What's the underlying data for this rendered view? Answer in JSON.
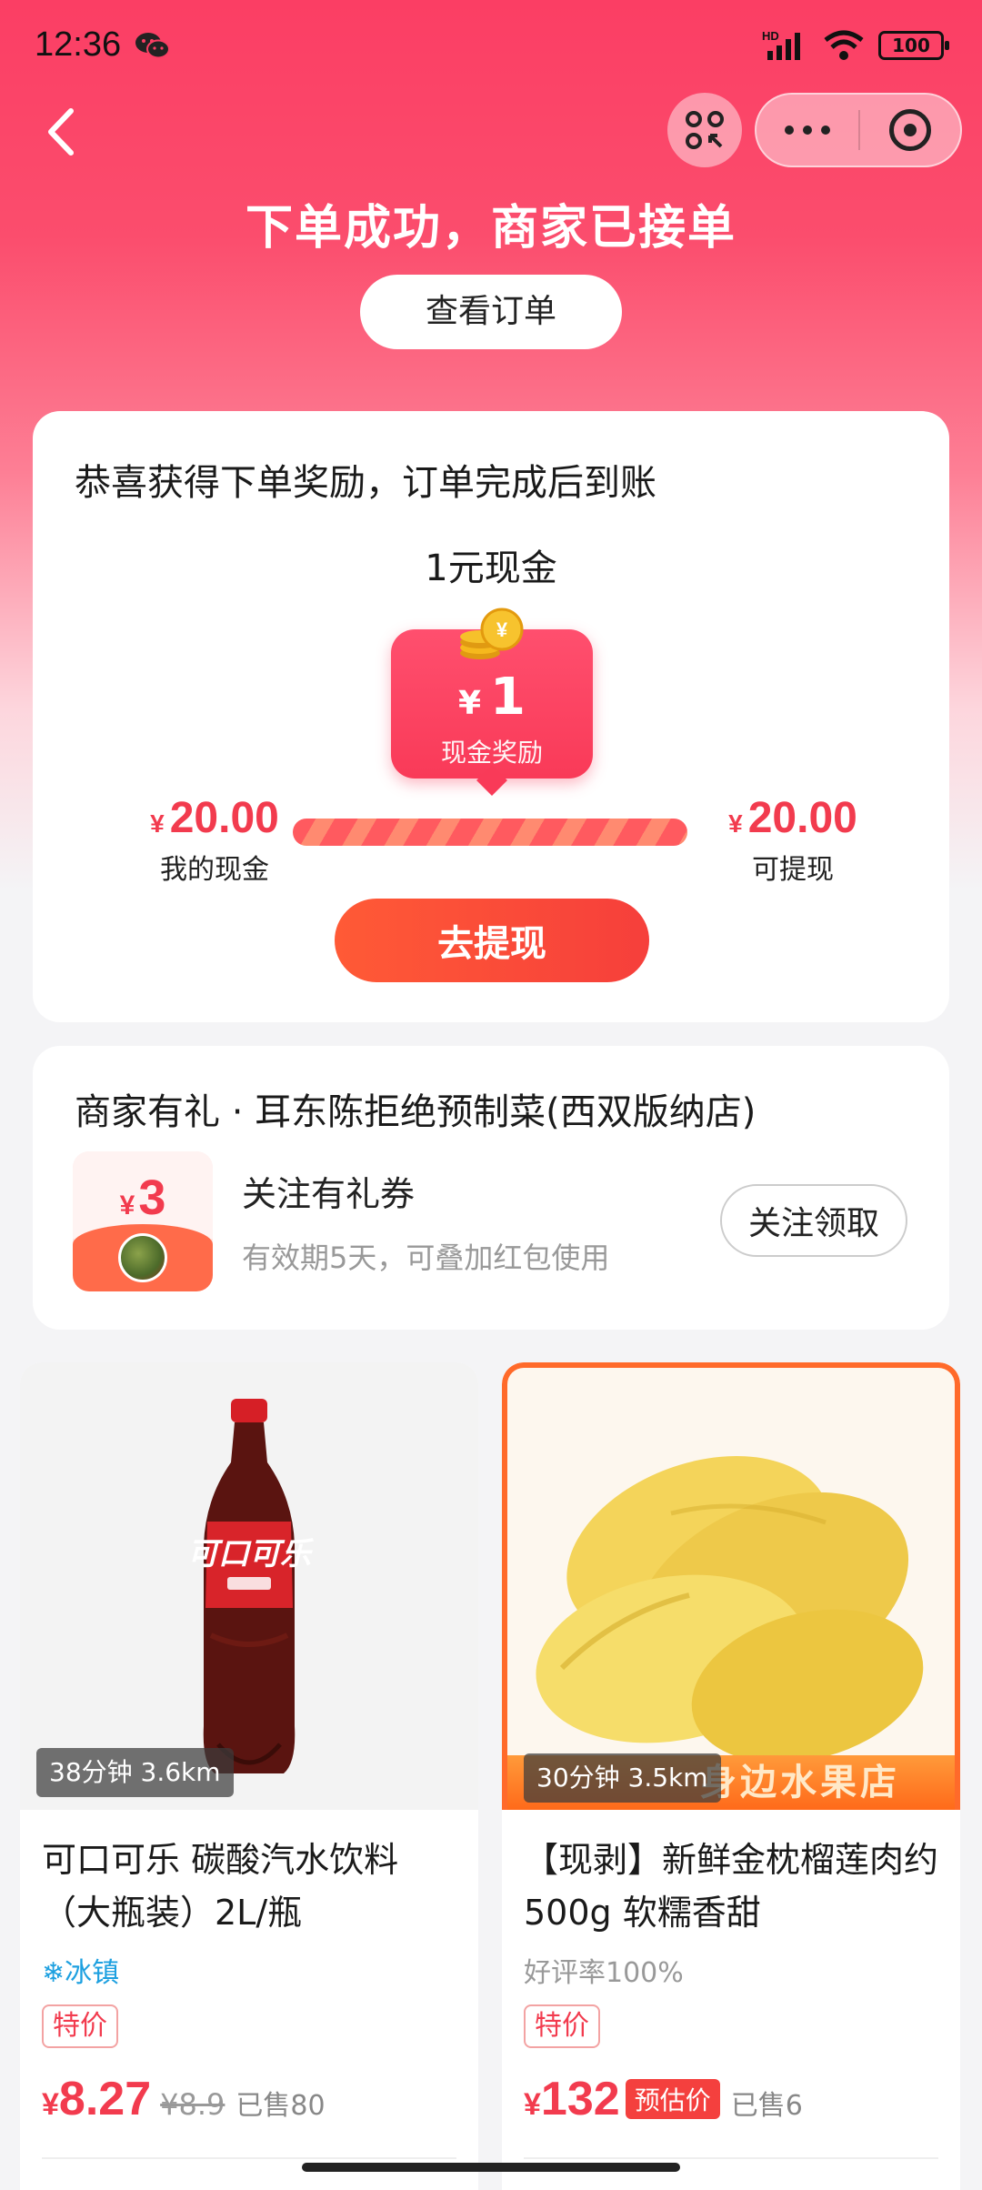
{
  "status_bar": {
    "time": "12:36",
    "network": "HD",
    "battery": "100"
  },
  "nav": {
    "back_icon": "chevron-left-icon",
    "scan_icon": "scan-icon",
    "more_icon": "more-dots-icon",
    "close_icon": "target-icon"
  },
  "header": {
    "title": "下单成功，商家已接单",
    "view_order_label": "查看订单"
  },
  "reward": {
    "title": "恭喜获得下单奖励，订单完成后到账",
    "amount_label": "1元现金",
    "bubble_currency": "¥",
    "bubble_value": "1",
    "bubble_caption": "现金奖励",
    "my_cash_currency": "¥",
    "my_cash_value": "20.00",
    "my_cash_label": "我的现金",
    "withdrawable_currency": "¥",
    "withdrawable_value": "20.00",
    "withdrawable_label": "可提现",
    "progress_fraction": 1.0,
    "withdraw_button": "去提现"
  },
  "merchant": {
    "title": "商家有礼 · 耳东陈拒绝预制菜(西双版纳店)",
    "coupon_currency": "¥",
    "coupon_value": "3",
    "coupon_name": "关注有礼券",
    "coupon_desc": "有效期5天，可叠加红包使用",
    "follow_button": "关注领取"
  },
  "products": [
    {
      "eta": "38分钟 3.6km",
      "name": "可口可乐 碳酸汽水饮料（大瓶装）2L/瓶",
      "tag": "❄冰镇",
      "promo": "特价",
      "currency": "¥",
      "price": "8.27",
      "original_price": "¥8.9",
      "sold": "已售80"
    },
    {
      "eta": "30分钟 3.5km",
      "shop_banner": "身边水果店",
      "name": "【现剥】新鲜金枕榴莲肉约500g 软糯香甜",
      "tag": "好评率100%",
      "promo": "特价",
      "currency": "¥",
      "price": "132",
      "estimate_label": "预估价",
      "sold": "已售6"
    }
  ],
  "colors": {
    "brand_red": "#f23b4e",
    "header_pink": "#fb3e64",
    "ice_blue": "#1da0e0",
    "button_orange": "#ff5a36"
  }
}
